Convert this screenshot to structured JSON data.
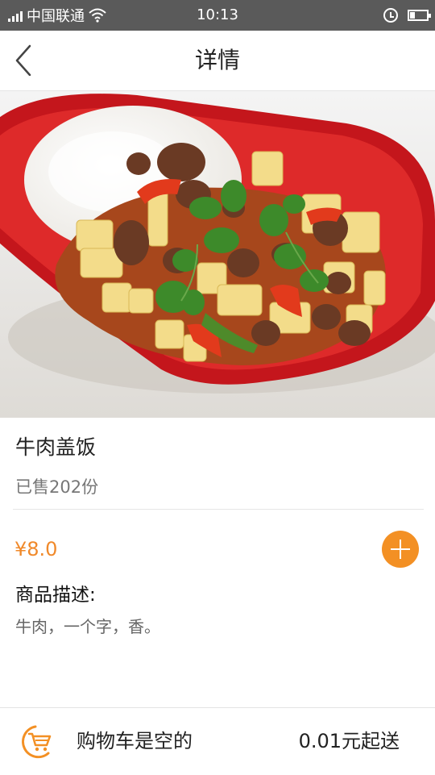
{
  "status_bar": {
    "carrier": "中国联通",
    "time": "10:13"
  },
  "header": {
    "title": "详情",
    "back_icon": "chevron-left-icon"
  },
  "product": {
    "name": "牛肉盖饭",
    "sold": "已售202份",
    "price": "¥8.0",
    "add_icon": "plus-circle-icon",
    "description_title": "商品描述:",
    "description": "牛肉，一个字，香。"
  },
  "cart": {
    "icon": "cart-icon",
    "empty_text": "购物车是空的",
    "min_order": "0.01元起送"
  },
  "colors": {
    "accent": "#f39024",
    "status_bar": "#5a5a5a"
  }
}
